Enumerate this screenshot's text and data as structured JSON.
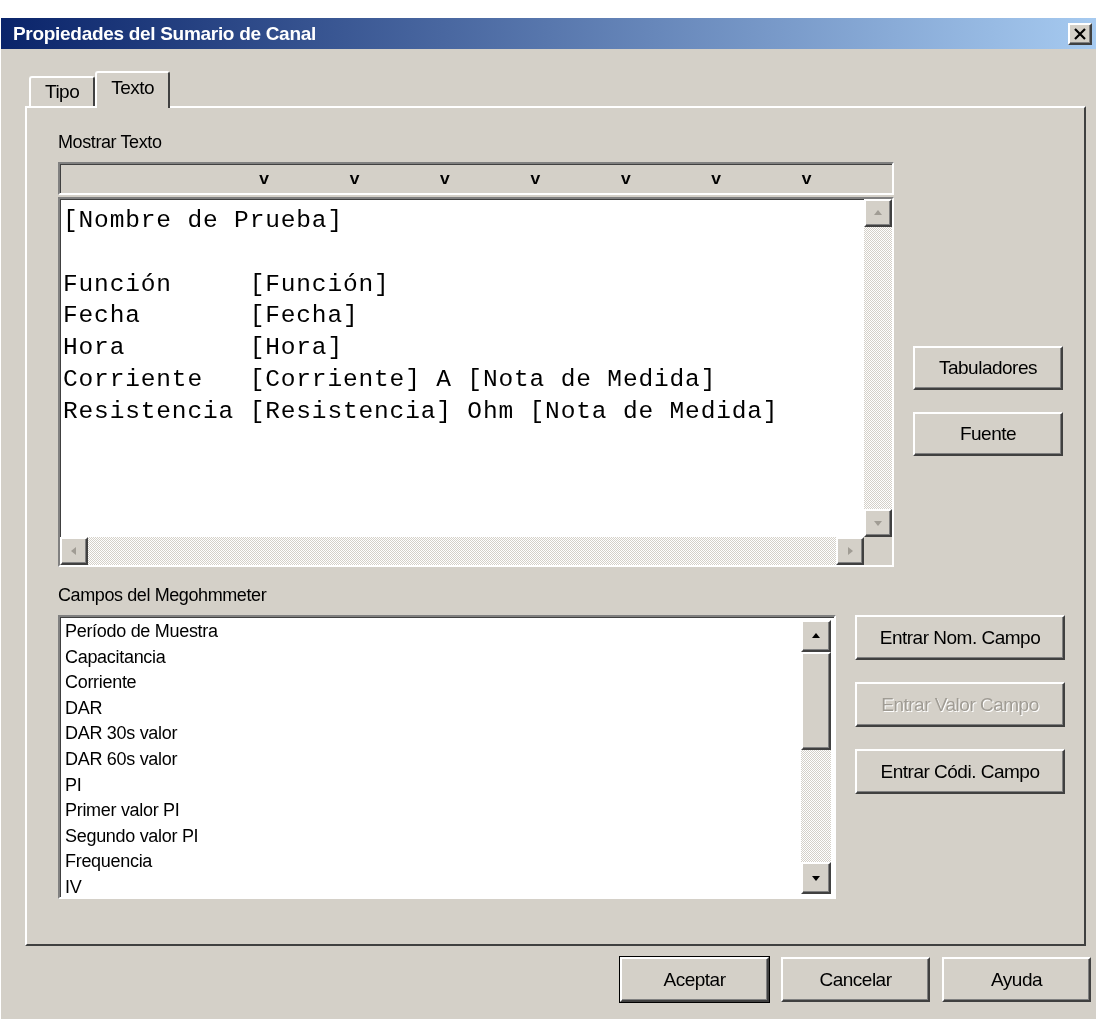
{
  "window": {
    "title": "Propiedades del Sumario de Canal"
  },
  "tabs": [
    {
      "label": "Tipo",
      "selected": false
    },
    {
      "label": "Texto",
      "selected": true
    }
  ],
  "text_section": {
    "label": "Mostrar Texto",
    "ruler_marks": [
      "v",
      "v",
      "v",
      "v",
      "v",
      "v",
      "v"
    ],
    "text": "[Nombre de Prueba]\n\nFunción     [Función]\nFecha       [Fecha]\nHora        [Hora]\nCorriente   [Corriente] A [Nota de Medida]\nResistencia [Resistencia] Ohm [Nota de Medida]",
    "buttons": [
      {
        "label": "Tabuladores",
        "disabled": false
      },
      {
        "label": "Fuente",
        "disabled": false
      }
    ]
  },
  "fields_section": {
    "label": "Campos del Megohmmeter",
    "items": [
      "Período de Muestra",
      "Capacitancia",
      "Corriente",
      "DAR",
      "DAR 30s valor",
      "DAR 60s valor",
      "PI",
      "Primer valor PI",
      "Segundo valor PI",
      "Frequencia",
      "IV"
    ],
    "buttons": [
      {
        "label": "Entrar Nom. Campo",
        "disabled": false
      },
      {
        "label": "Entrar Valor Campo",
        "disabled": true
      },
      {
        "label": "Entrar Códi. Campo",
        "disabled": false
      }
    ]
  },
  "buttons": [
    {
      "label": "Aceptar",
      "default": true
    },
    {
      "label": "Cancelar",
      "default": false
    },
    {
      "label": "Ayuda",
      "default": false
    }
  ]
}
